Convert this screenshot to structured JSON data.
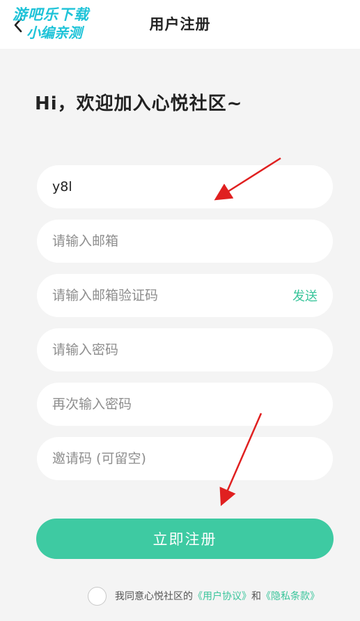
{
  "header": {
    "title": "用户注册",
    "back_icon": "chevron-left-icon"
  },
  "watermark": {
    "line1": "游吧乐下载",
    "line2": "小编亲测"
  },
  "greeting": "Hi，欢迎加入心悦社区~",
  "form": {
    "username_value": "y8l",
    "email_placeholder": "请输入邮箱",
    "code_placeholder": "请输入邮箱验证码",
    "send_label": "发送",
    "password_placeholder": "请输入密码",
    "confirm_placeholder": "再次输入密码",
    "invite_placeholder": "邀请码 (可留空)"
  },
  "submit_label": "立即注册",
  "agreement": {
    "prefix": "我同意心悦社区的",
    "terms": "《用户协议》",
    "and": "和",
    "privacy": "《隐私条款》"
  },
  "colors": {
    "accent": "#3ecaa2",
    "link": "#39c59b",
    "annotation": "#e02020"
  }
}
